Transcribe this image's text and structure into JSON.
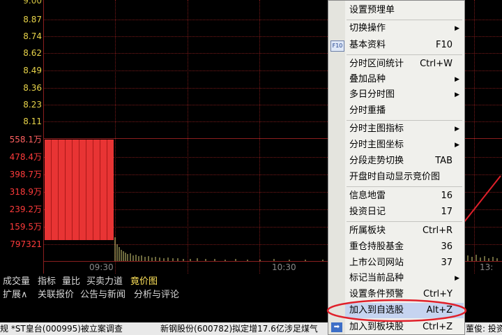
{
  "price_axis": [
    "9.00",
    "8.87",
    "8.74",
    "8.62",
    "8.49",
    "8.36",
    "8.23",
    "8.11"
  ],
  "volume_axis": [
    "558.1万",
    "478.4万",
    "398.7万",
    "318.9万",
    "239.2万",
    "159.5万",
    "797321"
  ],
  "time_labels": [
    "09:30",
    "10:30",
    "13:"
  ],
  "tabs_row1": [
    "成交量",
    "指标",
    "量比",
    "买卖力道",
    "竟价图"
  ],
  "tabs_row2": [
    "扩展∧",
    "关联报价",
    "公告与新闻",
    "分析与评论"
  ],
  "ticker": {
    "item1": "规 *ST皇台(000995)被立案调查",
    "item2": "新钢股份(600782)拟定增17.6亿涉足煤气",
    "item3": "董俊: 投资"
  },
  "menu": {
    "items": [
      {
        "label": "设置预埋单",
        "shortcut": "",
        "arrow": false
      },
      {
        "label": "切换操作",
        "shortcut": "",
        "arrow": true
      },
      {
        "label": "基本资料",
        "shortcut": "F10",
        "arrow": false
      },
      {
        "label": "分时区间统计",
        "shortcut": "Ctrl+W",
        "arrow": false
      },
      {
        "label": "叠加品种",
        "shortcut": "",
        "arrow": true
      },
      {
        "label": "多日分时图",
        "shortcut": "",
        "arrow": true
      },
      {
        "label": "分时重播",
        "shortcut": "",
        "arrow": false
      },
      {
        "label": "分时主图指标",
        "shortcut": "",
        "arrow": true
      },
      {
        "label": "分时主图坐标",
        "shortcut": "",
        "arrow": true
      },
      {
        "label": "分段走势切换",
        "shortcut": "TAB",
        "arrow": false
      },
      {
        "label": "开盘时自动显示竞价图",
        "shortcut": "",
        "arrow": false
      },
      {
        "label": "信息地雷",
        "shortcut": "16",
        "arrow": false
      },
      {
        "label": "投资日记",
        "shortcut": "17",
        "arrow": false
      },
      {
        "label": "所属板块",
        "shortcut": "Ctrl+R",
        "arrow": false
      },
      {
        "label": "重仓持股基金",
        "shortcut": "36",
        "arrow": false
      },
      {
        "label": "上市公司网站",
        "shortcut": "37",
        "arrow": false
      },
      {
        "label": "标记当前品种",
        "shortcut": "",
        "arrow": true
      },
      {
        "label": "设置条件预警",
        "shortcut": "Ctrl+Y",
        "arrow": false
      },
      {
        "label": "加入到自选股",
        "shortcut": "Alt+Z",
        "arrow": false
      },
      {
        "label": "加入到板块股",
        "shortcut": "Ctrl+Z",
        "arrow": false
      }
    ],
    "f10_icon_text": "F10"
  },
  "colors": {
    "price_axis": "#e8d44a",
    "volume_axis": "#ff3b3b",
    "volume_bars": "#e53030",
    "highlight_circle": "#e0202a"
  }
}
